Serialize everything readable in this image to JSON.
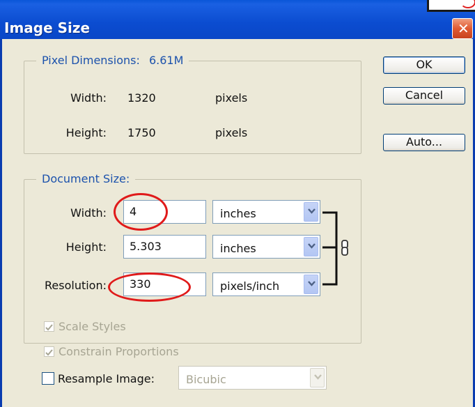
{
  "window": {
    "title": "Image Size",
    "close_glyph": "✕"
  },
  "pixel_dimensions": {
    "title": "Pixel Dimensions:",
    "size": "6.61M",
    "width_label": "Width:",
    "width_value": "1320",
    "width_unit": "pixels",
    "height_label": "Height:",
    "height_value": "1750",
    "height_unit": "pixels"
  },
  "buttons": {
    "ok": "OK",
    "cancel": "Cancel",
    "auto": "Auto..."
  },
  "document_size": {
    "title": "Document Size:",
    "width_label": "Width:",
    "width_value": "4",
    "width_unit": "inches",
    "height_label": "Height:",
    "height_value": "5.303",
    "height_unit": "inches",
    "resolution_label": "Resolution:",
    "resolution_value": "330",
    "resolution_unit": "pixels/inch",
    "link_icon": "chain-link-icon"
  },
  "options": {
    "scale_styles": {
      "label": "Scale Styles",
      "checked": true,
      "enabled": false
    },
    "constrain_proportions": {
      "label": "Constrain Proportions",
      "checked": true,
      "enabled": false
    },
    "resample_image": {
      "label": "Resample Image:",
      "checked": false,
      "enabled": true,
      "method": "Bicubic"
    }
  },
  "colors": {
    "accent": "#1c52ac",
    "titlebar": "#0a4cd0",
    "annotation": "#e01a1a",
    "dialog_bg": "#ece9d8"
  }
}
